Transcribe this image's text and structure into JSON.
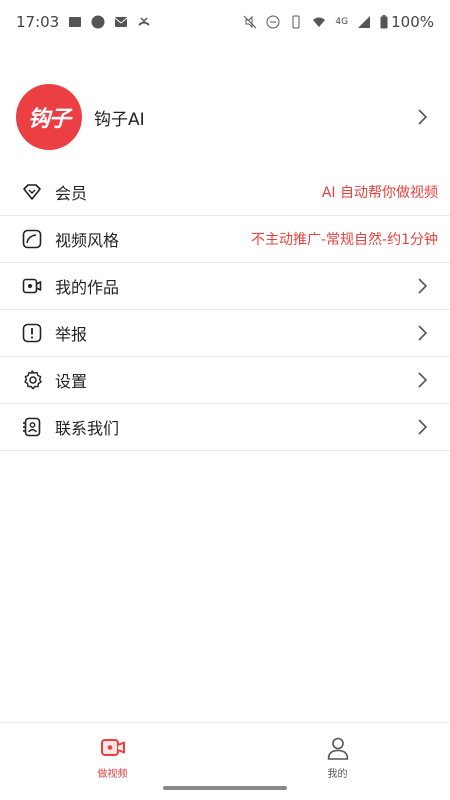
{
  "status_bar": {
    "time": "17:03",
    "network": "4G",
    "battery": "100%"
  },
  "profile": {
    "avatar_text": "钩子",
    "name": "钩子AI"
  },
  "menu": {
    "items": [
      {
        "label": "会员",
        "value": "AI 自动帮你做视频",
        "icon": "diamond-icon"
      },
      {
        "label": "视频风格",
        "value": "不主动推广-常规自然-约1分钟",
        "icon": "style-icon"
      },
      {
        "label": "我的作品",
        "value": "",
        "icon": "video-camera-icon"
      },
      {
        "label": "举报",
        "value": "",
        "icon": "report-icon"
      },
      {
        "label": "设置",
        "value": "",
        "icon": "gear-icon"
      },
      {
        "label": "联系我们",
        "value": "",
        "icon": "contact-book-icon"
      }
    ]
  },
  "bottom_nav": {
    "tabs": [
      {
        "label": "做视频",
        "icon": "video-camera-icon",
        "active": true
      },
      {
        "label": "我的",
        "icon": "person-icon",
        "active": false
      }
    ]
  },
  "colors": {
    "accent": "#e8413f",
    "avatar_bg": "#ec3f44"
  }
}
